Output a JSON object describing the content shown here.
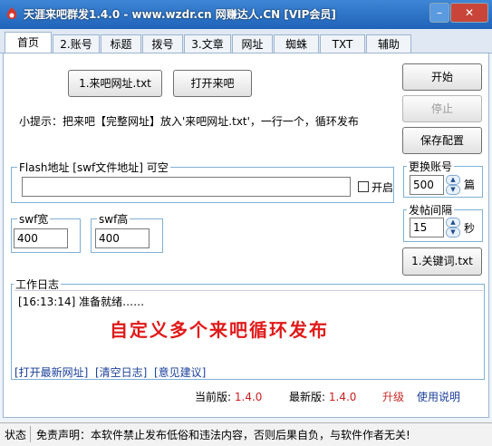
{
  "window": {
    "title": "天涯来吧群发1.4.0 - www.wzdr.cn 网赚达人.CN [VIP会员]",
    "min_label": "–",
    "close_label": "✕",
    "accent_color": "#1f63b8"
  },
  "tabs": [
    "首页",
    "2.账号",
    "标题",
    "拨号",
    "3.文章",
    "网址",
    "蜘蛛",
    "TXT",
    "辅助"
  ],
  "main": {
    "url_file_button": "1.来吧网址.txt",
    "open_laiba_button": "打开来吧",
    "tip": "小提示：把来吧【完整网址】放入'来吧网址.txt'，一行一个，循环发布",
    "start_button": "开始",
    "stop_button": "停止",
    "save_config_button": "保存配置"
  },
  "flash": {
    "group_title": "Flash地址 [swf文件地址] 可空",
    "url_value": "",
    "enable_label": "开启",
    "enabled": false
  },
  "swf_width": {
    "title": "swf宽",
    "value": "400"
  },
  "swf_height": {
    "title": "swf高",
    "value": "400"
  },
  "account_switch": {
    "title": "更换账号",
    "value": "500",
    "unit": "篇"
  },
  "post_interval": {
    "title": "发帖间隔",
    "value": "15",
    "unit": "秒"
  },
  "keywords_button": "1.关键词.txt",
  "log": {
    "title": "工作日志",
    "lines": [
      {
        "time": "[16:13:14]",
        "text": "准备就绪……"
      }
    ],
    "banner": "自定义多个来吧循环发布",
    "banner_color": "#e01a1a",
    "links": [
      "[打开最新网址]",
      "[清空日志]",
      "[意见建议]"
    ]
  },
  "version": {
    "current_label": "当前版:",
    "current_value": "1.4.0",
    "latest_label": "最新版:",
    "latest_value": "1.4.0",
    "upgrade": "升级",
    "help": "使用说明"
  },
  "status": {
    "label": "状态",
    "disclaimer": "免责声明：本软件禁止发布低俗和违法内容，否则后果自负，与软件作者无关!"
  }
}
